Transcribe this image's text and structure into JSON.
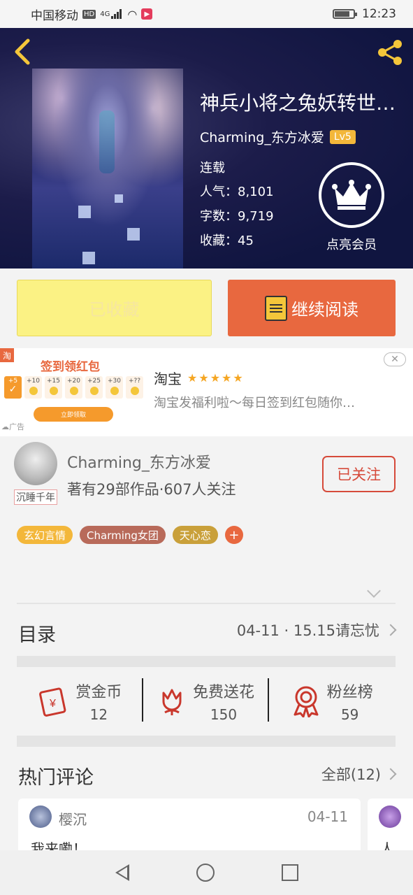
{
  "status_bar": {
    "carrier": "中国移动",
    "hd": "HD",
    "network": "4G",
    "time": "12:23"
  },
  "book": {
    "title": "神兵小将之兔妖转世…",
    "author": "Charming_东方冰爱",
    "level": "Lv5",
    "state": "连载",
    "popularity_label": "人气：",
    "popularity": "8,101",
    "words_label": "字数：",
    "words": "9,719",
    "favorites_label": "收藏：",
    "favorites": "45",
    "vip_label": "点亮会员"
  },
  "actions": {
    "favorited": "已收藏",
    "continue_reading": "继续阅读"
  },
  "ad": {
    "banner_title": "签到领红包",
    "coins": [
      "+5",
      "+10",
      "+15",
      "+20",
      "+25",
      "+30",
      "+??"
    ],
    "claim_button": "立即领取",
    "ad_label": "广告",
    "shop_name": "淘宝",
    "stars": "★★★★★",
    "description": "淘宝发福利啦～每日签到红包随你…",
    "taobao_icon": "淘"
  },
  "author_card": {
    "name": "Charming_东方冰爱",
    "avatar_tag": "沉睡千年",
    "stats": "著有29部作品·607人关注",
    "follow_label": "已关注",
    "tags": [
      {
        "label": "玄幻言情",
        "color": "#f3b73a"
      },
      {
        "label": "Charming女团",
        "color": "#b86a5a"
      },
      {
        "label": "天心恋",
        "color": "#c9a03a"
      }
    ],
    "add_tag": "+"
  },
  "catalog": {
    "label": "目录",
    "latest": "04-11 · 15.15请忘忧"
  },
  "rewards": [
    {
      "label": "赏金币",
      "count": "12",
      "icon": "red-envelope-icon"
    },
    {
      "label": "免费送花",
      "count": "150",
      "icon": "flower-icon"
    },
    {
      "label": "粉丝榜",
      "count": "59",
      "icon": "ribbon-medal-icon"
    }
  ],
  "comments": {
    "label": "热门评论",
    "all": "全部(12)",
    "items": [
      {
        "user": "樱沉",
        "date": "04-11",
        "text": "我来嘞！"
      },
      {
        "user": "",
        "date": "",
        "text": "人"
      }
    ]
  },
  "colors": {
    "accent_orange": "#e8683f",
    "gold": "#f4c63a",
    "follow_red": "#d64a3a",
    "icon_red": "#c9372c"
  }
}
